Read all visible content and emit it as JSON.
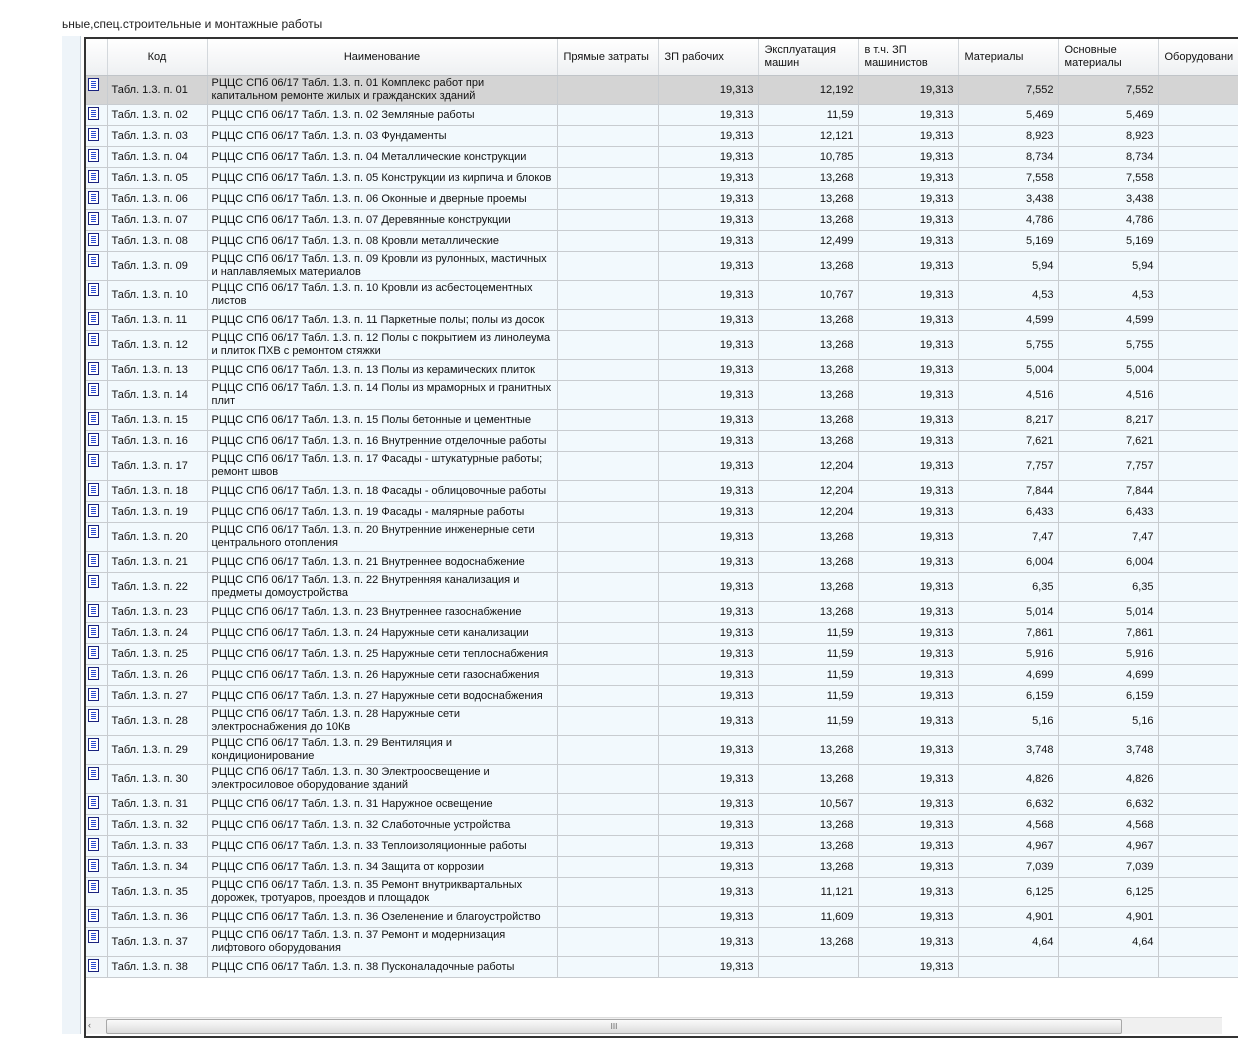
{
  "window": {
    "title": "ьные,спец.строительные и монтажные работы"
  },
  "columns": [
    "Код",
    "Наименование",
    "Прямые затраты",
    "ЗП рабочих",
    "Эксплуатация машин",
    "в т.ч. ЗП машинистов",
    "Материалы",
    "Основные материалы",
    "Оборудовани"
  ],
  "selected_row": 0,
  "rows": [
    [
      "Табл. 1.3. п. 01",
      "РЦЦС СПб 06/17 Табл. 1.3. п. 01 Комплекс работ при капитальном ремонте жилых и гражданских зданий",
      "",
      "19,313",
      "12,192",
      "19,313",
      "7,552",
      "7,552",
      ""
    ],
    [
      "Табл. 1.3. п. 02",
      "РЦЦС СПб 06/17 Табл. 1.3. п. 02 Земляные работы",
      "",
      "19,313",
      "11,59",
      "19,313",
      "5,469",
      "5,469",
      ""
    ],
    [
      "Табл. 1.3. п. 03",
      "РЦЦС СПб 06/17 Табл. 1.3. п. 03 Фундаменты",
      "",
      "19,313",
      "12,121",
      "19,313",
      "8,923",
      "8,923",
      ""
    ],
    [
      "Табл. 1.3. п. 04",
      "РЦЦС СПб 06/17 Табл. 1.3. п. 04 Металлические конструкции",
      "",
      "19,313",
      "10,785",
      "19,313",
      "8,734",
      "8,734",
      ""
    ],
    [
      "Табл. 1.3. п. 05",
      "РЦЦС СПб 06/17 Табл. 1.3. п. 05 Конструкции из кирпича и блоков",
      "",
      "19,313",
      "13,268",
      "19,313",
      "7,558",
      "7,558",
      ""
    ],
    [
      "Табл. 1.3. п. 06",
      "РЦЦС СПб 06/17 Табл. 1.3. п. 06 Оконные и дверные проемы",
      "",
      "19,313",
      "13,268",
      "19,313",
      "3,438",
      "3,438",
      ""
    ],
    [
      "Табл. 1.3. п. 07",
      "РЦЦС СПб 06/17 Табл. 1.3. п. 07 Деревянные конструкции",
      "",
      "19,313",
      "13,268",
      "19,313",
      "4,786",
      "4,786",
      ""
    ],
    [
      "Табл. 1.3. п. 08",
      "РЦЦС СПб 06/17 Табл. 1.3. п. 08 Кровли металлические",
      "",
      "19,313",
      "12,499",
      "19,313",
      "5,169",
      "5,169",
      ""
    ],
    [
      "Табл. 1.3. п. 09",
      "РЦЦС СПб 06/17 Табл. 1.3. п. 09 Кровли из рулонных, мастичных и наплавляемых материалов",
      "",
      "19,313",
      "13,268",
      "19,313",
      "5,94",
      "5,94",
      ""
    ],
    [
      "Табл. 1.3. п. 10",
      "РЦЦС СПб 06/17 Табл. 1.3. п. 10 Кровли из асбестоцементных листов",
      "",
      "19,313",
      "10,767",
      "19,313",
      "4,53",
      "4,53",
      ""
    ],
    [
      "Табл. 1.3. п. 11",
      "РЦЦС СПб 06/17 Табл. 1.3. п. 11 Паркетные полы; полы из досок",
      "",
      "19,313",
      "13,268",
      "19,313",
      "4,599",
      "4,599",
      ""
    ],
    [
      "Табл. 1.3. п. 12",
      "РЦЦС СПб 06/17 Табл. 1.3. п. 12 Полы с покрытием из линолеума и плиток ПХВ с ремонтом стяжки",
      "",
      "19,313",
      "13,268",
      "19,313",
      "5,755",
      "5,755",
      ""
    ],
    [
      "Табл. 1.3. п. 13",
      "РЦЦС СПб 06/17 Табл. 1.3. п. 13 Полы из керамических плиток",
      "",
      "19,313",
      "13,268",
      "19,313",
      "5,004",
      "5,004",
      ""
    ],
    [
      "Табл. 1.3. п. 14",
      "РЦЦС СПб 06/17 Табл. 1.3. п. 14 Полы из мраморных и гранитных плит",
      "",
      "19,313",
      "13,268",
      "19,313",
      "4,516",
      "4,516",
      ""
    ],
    [
      "Табл. 1.3. п. 15",
      "РЦЦС СПб 06/17 Табл. 1.3. п. 15 Полы бетонные и цементные",
      "",
      "19,313",
      "13,268",
      "19,313",
      "8,217",
      "8,217",
      ""
    ],
    [
      "Табл. 1.3. п. 16",
      "РЦЦС СПб 06/17 Табл. 1.3. п. 16 Внутренние отделочные работы",
      "",
      "19,313",
      "13,268",
      "19,313",
      "7,621",
      "7,621",
      ""
    ],
    [
      "Табл. 1.3. п. 17",
      "РЦЦС СПб 06/17 Табл. 1.3. п. 17 Фасады - штукатурные работы; ремонт швов",
      "",
      "19,313",
      "12,204",
      "19,313",
      "7,757",
      "7,757",
      ""
    ],
    [
      "Табл. 1.3. п. 18",
      "РЦЦС СПб 06/17 Табл. 1.3. п. 18 Фасады - облицовочные работы",
      "",
      "19,313",
      "12,204",
      "19,313",
      "7,844",
      "7,844",
      ""
    ],
    [
      "Табл. 1.3. п. 19",
      "РЦЦС СПб 06/17 Табл. 1.3. п. 19 Фасады - малярные работы",
      "",
      "19,313",
      "12,204",
      "19,313",
      "6,433",
      "6,433",
      ""
    ],
    [
      "Табл. 1.3. п. 20",
      "РЦЦС СПб 06/17 Табл. 1.3. п. 20 Внутренние инженерные сети центрального отопления",
      "",
      "19,313",
      "13,268",
      "19,313",
      "7,47",
      "7,47",
      ""
    ],
    [
      "Табл. 1.3. п. 21",
      "РЦЦС СПб 06/17 Табл. 1.3. п. 21 Внутреннее водоснабжение",
      "",
      "19,313",
      "13,268",
      "19,313",
      "6,004",
      "6,004",
      ""
    ],
    [
      "Табл. 1.3. п. 22",
      "РЦЦС СПб 06/17 Табл. 1.3. п. 22 Внутренняя канализация и предметы домоустройства",
      "",
      "19,313",
      "13,268",
      "19,313",
      "6,35",
      "6,35",
      ""
    ],
    [
      "Табл. 1.3. п. 23",
      "РЦЦС СПб 06/17 Табл. 1.3. п. 23 Внутреннее газоснабжение",
      "",
      "19,313",
      "13,268",
      "19,313",
      "5,014",
      "5,014",
      ""
    ],
    [
      "Табл. 1.3. п. 24",
      "РЦЦС СПб 06/17 Табл. 1.3. п. 24 Наружные сети канализации",
      "",
      "19,313",
      "11,59",
      "19,313",
      "7,861",
      "7,861",
      ""
    ],
    [
      "Табл. 1.3. п. 25",
      "РЦЦС СПб 06/17 Табл. 1.3. п. 25 Наружные сети теплоснабжения",
      "",
      "19,313",
      "11,59",
      "19,313",
      "5,916",
      "5,916",
      ""
    ],
    [
      "Табл. 1.3. п. 26",
      "РЦЦС СПб 06/17 Табл. 1.3. п. 26 Наружные сети газоснабжения",
      "",
      "19,313",
      "11,59",
      "19,313",
      "4,699",
      "4,699",
      ""
    ],
    [
      "Табл. 1.3. п. 27",
      "РЦЦС СПб 06/17 Табл. 1.3. п. 27 Наружные сети водоснабжения",
      "",
      "19,313",
      "11,59",
      "19,313",
      "6,159",
      "6,159",
      ""
    ],
    [
      "Табл. 1.3. п. 28",
      "РЦЦС СПб 06/17 Табл. 1.3. п. 28 Наружные сети электроснабжения до 10Кв",
      "",
      "19,313",
      "11,59",
      "19,313",
      "5,16",
      "5,16",
      ""
    ],
    [
      "Табл. 1.3. п. 29",
      "РЦЦС СПб 06/17 Табл. 1.3. п. 29 Вентиляция и кондиционирование",
      "",
      "19,313",
      "13,268",
      "19,313",
      "3,748",
      "3,748",
      ""
    ],
    [
      "Табл. 1.3. п. 30",
      "РЦЦС СПб 06/17 Табл. 1.3. п. 30 Электроосвещение и электросиловое оборудование зданий",
      "",
      "19,313",
      "13,268",
      "19,313",
      "4,826",
      "4,826",
      ""
    ],
    [
      "Табл. 1.3. п. 31",
      "РЦЦС СПб 06/17 Табл. 1.3. п. 31 Наружное освещение",
      "",
      "19,313",
      "10,567",
      "19,313",
      "6,632",
      "6,632",
      ""
    ],
    [
      "Табл. 1.3. п. 32",
      "РЦЦС СПб 06/17 Табл. 1.3. п. 32 Слаботочные устройства",
      "",
      "19,313",
      "13,268",
      "19,313",
      "4,568",
      "4,568",
      ""
    ],
    [
      "Табл. 1.3. п. 33",
      "РЦЦС СПб 06/17 Табл. 1.3. п. 33 Теплоизоляционные работы",
      "",
      "19,313",
      "13,268",
      "19,313",
      "4,967",
      "4,967",
      ""
    ],
    [
      "Табл. 1.3. п. 34",
      "РЦЦС СПб 06/17 Табл. 1.3. п. 34 Защита от коррозии",
      "",
      "19,313",
      "13,268",
      "19,313",
      "7,039",
      "7,039",
      ""
    ],
    [
      "Табл. 1.3. п. 35",
      "РЦЦС СПб 06/17 Табл. 1.3. п. 35 Ремонт внутриквартальных дорожек, тротуаров, проездов и площадок",
      "",
      "19,313",
      "11,121",
      "19,313",
      "6,125",
      "6,125",
      ""
    ],
    [
      "Табл. 1.3. п. 36",
      "РЦЦС СПб 06/17 Табл. 1.3. п. 36 Озеленение и благоустройство",
      "",
      "19,313",
      "11,609",
      "19,313",
      "4,901",
      "4,901",
      ""
    ],
    [
      "Табл. 1.3. п. 37",
      "РЦЦС СПб 06/17 Табл. 1.3. п. 37 Ремонт и модернизация лифтового оборудования",
      "",
      "19,313",
      "13,268",
      "19,313",
      "4,64",
      "4,64",
      ""
    ],
    [
      "Табл. 1.3. п. 38",
      "РЦЦС СПб 06/17 Табл. 1.3. п. 38 Пусконаладочные работы",
      "",
      "19,313",
      "",
      "19,313",
      "",
      "",
      ""
    ]
  ],
  "scrollbar": {
    "grip": "III",
    "left_arrow": "‹"
  }
}
